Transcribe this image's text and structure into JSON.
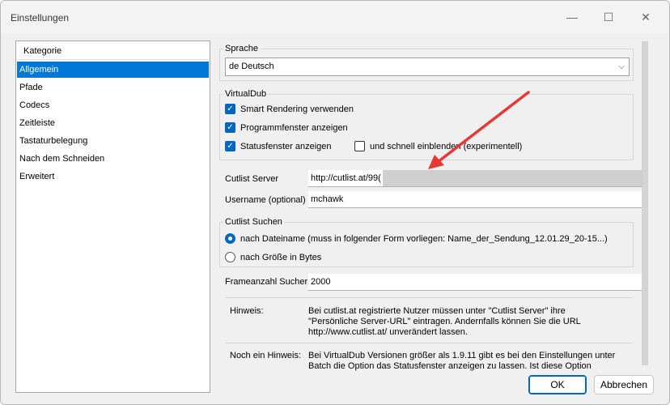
{
  "window": {
    "title": "Einstellungen",
    "min_glyph": "—",
    "max_glyph": "☐",
    "close_glyph": "✕"
  },
  "category": {
    "header": "Kategorie",
    "items": [
      "Allgemein",
      "Pfade",
      "Codecs",
      "Zeitleiste",
      "Tastaturbelegung",
      "Nach dem Schneiden",
      "Erweitert"
    ],
    "selected": "Allgemein"
  },
  "sprache": {
    "label": "Sprache",
    "value": "de Deutsch"
  },
  "virtualdub": {
    "label": "VirtualDub",
    "smart_rendering": "Smart Rendering verwenden",
    "programmfenster": "Programmfenster anzeigen",
    "statusfenster": "Statusfenster anzeigen",
    "schnell": "und schnell einblenden (experimentell)"
  },
  "server": {
    "label": "Cutlist Server",
    "value": "http://cutlist.at/99("
  },
  "username": {
    "label": "Username (optional)",
    "value": "mchawk"
  },
  "suchen": {
    "label": "Cutlist Suchen",
    "option1": "nach Dateiname (muss in folgender Form vorliegen:  Name_der_Sendung_12.01.29_20-15...)",
    "option2": "nach Größe in Bytes"
  },
  "frameanzahl": {
    "label": "Frameanzahl Sucher",
    "value": "2000"
  },
  "hinweis": {
    "label": "Hinweis:",
    "text": "Bei cutlist.at registrierte Nutzer müssen unter \"Cutlist Server\" ihre \"Persönliche Server-URL\" eintragen. Andernfalls können Sie die URL http://www.cutlist.at/ unverändert lassen."
  },
  "hinweis2": {
    "label": "Noch ein Hinweis:",
    "text": "Bei VirtualDub Versionen größer als 1.9.11 gibt es bei den Einstellungen unter Batch die Option das Statusfenster anzeigen zu lassen. Ist diese Option aktiviert,"
  },
  "buttons": {
    "ok": "OK",
    "cancel": "Abbrechen"
  },
  "icons": {
    "check": "✓",
    "chevron": "⌵"
  },
  "colors": {
    "accent": "#0078d7",
    "arrow": "#e53935"
  }
}
